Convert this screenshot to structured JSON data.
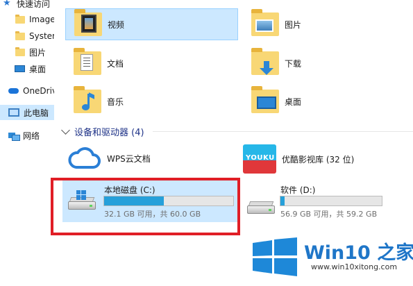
{
  "sidebar": {
    "items": [
      {
        "label": "快速访问",
        "icon": "star-icon"
      },
      {
        "label": "Image",
        "icon": "folder-icon"
      },
      {
        "label": "System",
        "icon": "folder-icon"
      },
      {
        "label": "图片",
        "icon": "folder-icon"
      },
      {
        "label": "桌面",
        "icon": "desktop-icon"
      },
      {
        "label": "OneDrive",
        "icon": "onedrive-icon"
      },
      {
        "label": "此电脑",
        "icon": "this-pc-icon"
      },
      {
        "label": "网络",
        "icon": "network-icon"
      }
    ]
  },
  "folders": [
    {
      "name": "视频",
      "icon": "videos-folder-icon"
    },
    {
      "name": "图片",
      "icon": "pictures-folder-icon"
    },
    {
      "name": "文档",
      "icon": "documents-folder-icon"
    },
    {
      "name": "下载",
      "icon": "downloads-folder-icon"
    },
    {
      "name": "音乐",
      "icon": "music-folder-icon"
    },
    {
      "name": "桌面",
      "icon": "desktop-folder-icon"
    }
  ],
  "devices_group": {
    "title": "设备和驱动器 (4)"
  },
  "devices": [
    {
      "name": "WPS云文档",
      "icon": "wps-cloud-icon"
    },
    {
      "name": "优酷影视库 (32 位)",
      "icon": "youku-icon",
      "logo_text": "YOUKU"
    }
  ],
  "drives": [
    {
      "name": "本地磁盘 (C:)",
      "free_text": "32.1 GB 可用，共 60.0 GB",
      "used_fraction": 0.465,
      "icon": "windows-drive-icon"
    },
    {
      "name": "软件 (D:)",
      "free_text": "56.9 GB 可用，共 59.2 GB",
      "used_fraction": 0.039,
      "icon": "drive-icon"
    }
  ],
  "watermark": {
    "title": "Win10 之家",
    "url": "www.win10xitong.com"
  },
  "colors": {
    "accent": "#26a0da",
    "selection": "#cce8ff",
    "highlight_border": "#e01e26",
    "group_header": "#1e3287"
  }
}
